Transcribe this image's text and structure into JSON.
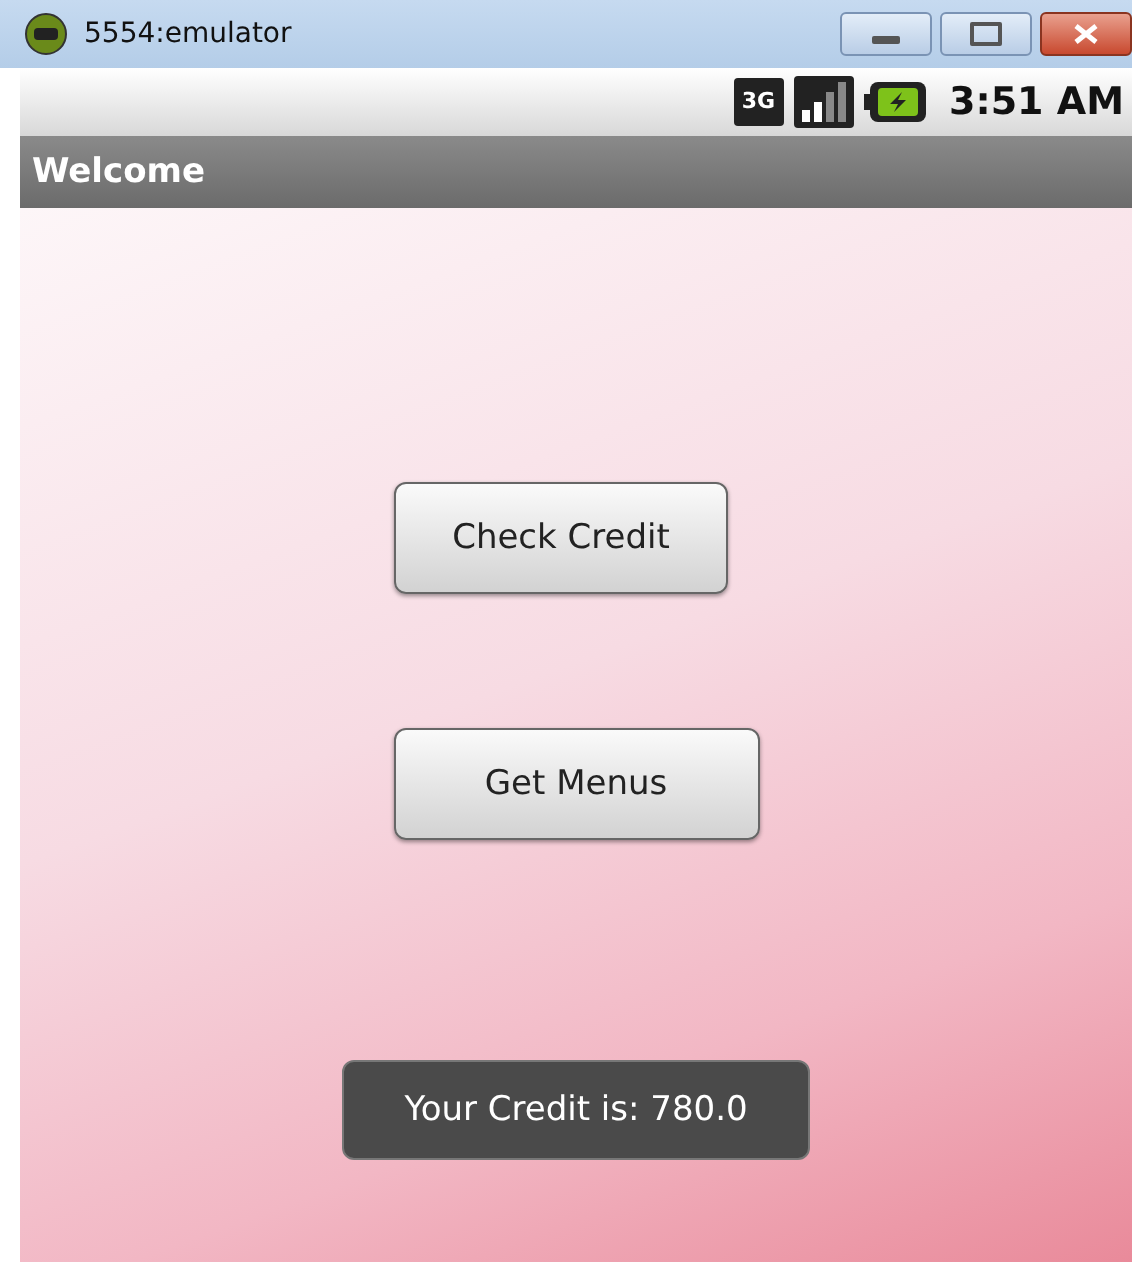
{
  "window": {
    "title": "5554:emulator"
  },
  "status_bar": {
    "network_type": "3G",
    "time": "3:51 AM"
  },
  "app_bar": {
    "title": "Welcome"
  },
  "buttons": [
    {
      "label": "Check Credit"
    },
    {
      "label": "Get Menus"
    }
  ],
  "toast": {
    "text": "Your Credit is: 780.0"
  }
}
